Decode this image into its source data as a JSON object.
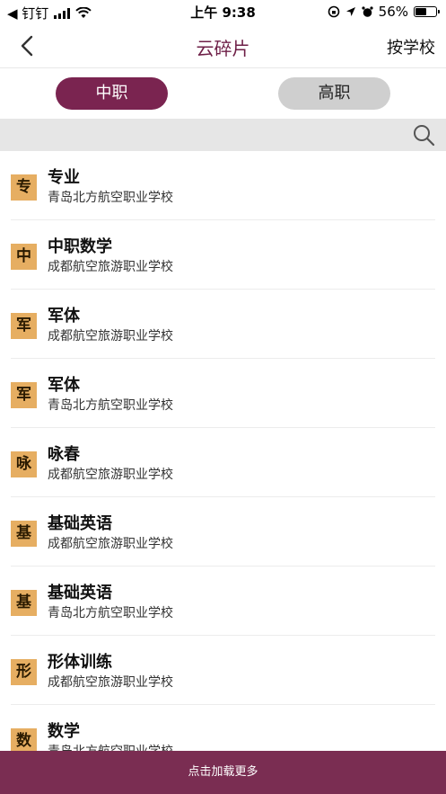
{
  "status_bar": {
    "back_label": "◀ 钉钉",
    "time": "上午 9:38",
    "battery": "56%",
    "battery_level": 0.56
  },
  "nav": {
    "title": "云碎片",
    "right_label": "按学校"
  },
  "segment": {
    "active": "中职",
    "inactive": "高职"
  },
  "search": {},
  "list": [
    {
      "badge": "专",
      "title": "专业",
      "school": "青岛北方航空职业学校"
    },
    {
      "badge": "中",
      "title": "中职数学",
      "school": "成都航空旅游职业学校"
    },
    {
      "badge": "军",
      "title": "军体",
      "school": "成都航空旅游职业学校"
    },
    {
      "badge": "军",
      "title": "军体",
      "school": "青岛北方航空职业学校"
    },
    {
      "badge": "咏",
      "title": "咏春",
      "school": "成都航空旅游职业学校"
    },
    {
      "badge": "基",
      "title": "基础英语",
      "school": "成都航空旅游职业学校"
    },
    {
      "badge": "基",
      "title": "基础英语",
      "school": "青岛北方航空职业学校"
    },
    {
      "badge": "形",
      "title": "形体训练",
      "school": "成都航空旅游职业学校"
    },
    {
      "badge": "数",
      "title": "数学",
      "school": "青岛北方航空职业学校"
    }
  ],
  "load_more": "点击加载更多",
  "colors": {
    "brand": "#7a2450",
    "badge": "#e6ae62",
    "title": "#6e1f47"
  }
}
